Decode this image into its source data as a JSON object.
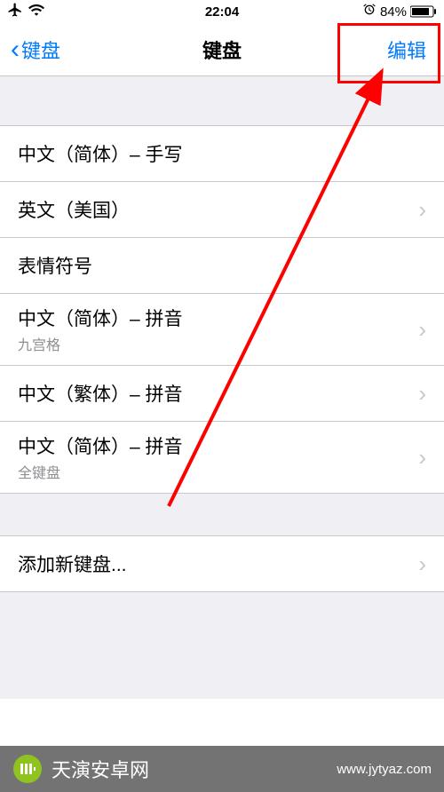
{
  "statusBar": {
    "time": "22:04",
    "batteryPercent": "84%"
  },
  "nav": {
    "backLabel": "键盘",
    "title": "键盘",
    "editLabel": "编辑"
  },
  "keyboards": [
    {
      "label": "中文（简体）– 手写",
      "sublabel": "",
      "chevron": false
    },
    {
      "label": "英文（美国）",
      "sublabel": "",
      "chevron": true
    },
    {
      "label": "表情符号",
      "sublabel": "",
      "chevron": false
    },
    {
      "label": "中文（简体）– 拼音",
      "sublabel": "九宫格",
      "chevron": true
    },
    {
      "label": "中文（繁体）– 拼音",
      "sublabel": "",
      "chevron": true
    },
    {
      "label": "中文（简体）– 拼音",
      "sublabel": "全键盘",
      "chevron": true
    }
  ],
  "addNew": {
    "label": "添加新键盘..."
  },
  "watermark": {
    "brand": "天演安卓网",
    "url": "www.jytyaz.com"
  }
}
